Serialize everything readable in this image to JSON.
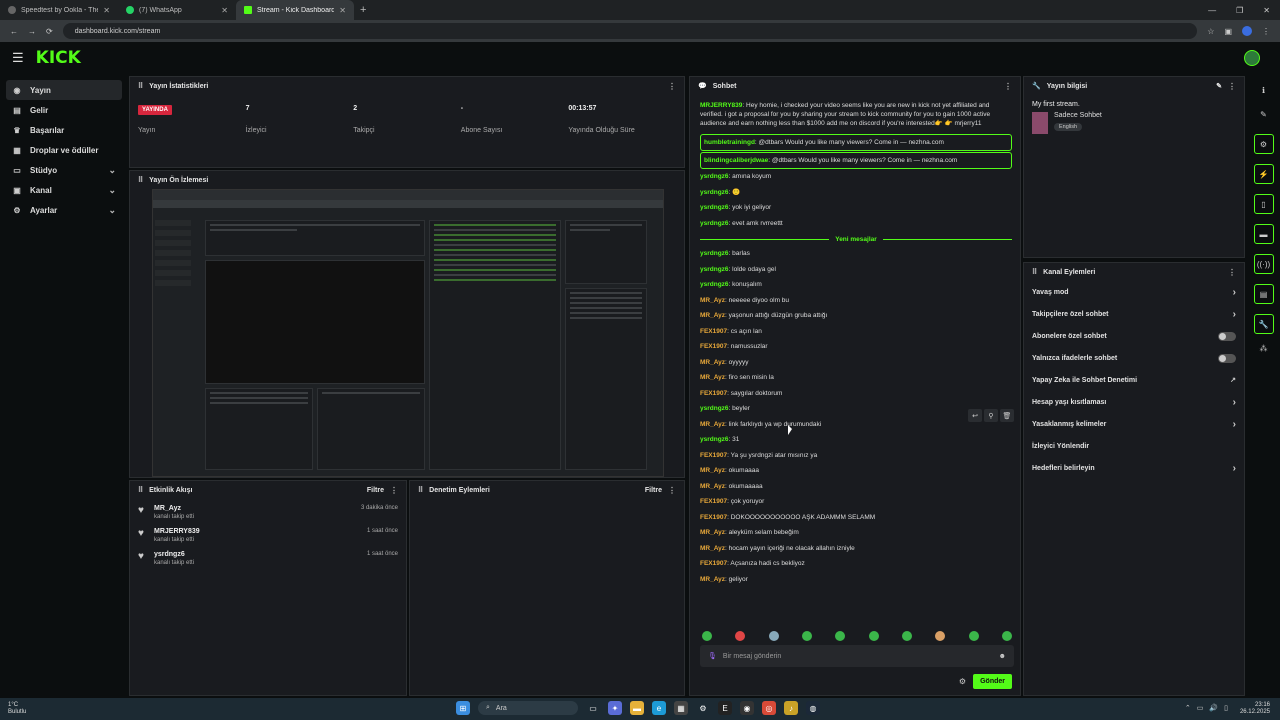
{
  "browser": {
    "tabs": [
      {
        "title": "Speedtest by Ookla - The Glob",
        "color": "#5a5a5a"
      },
      {
        "title": "(7) WhatsApp",
        "color": "#25d366"
      },
      {
        "title": "Stream - Kick Dashboard",
        "color": "#53fc18"
      }
    ],
    "url": "dashboard.kick.com/stream"
  },
  "app": {
    "logo": "KICK"
  },
  "sidebar": {
    "items": [
      {
        "label": "Yayın",
        "icon": "broadcast-icon"
      },
      {
        "label": "Gelir",
        "icon": "revenue-icon"
      },
      {
        "label": "Başarılar",
        "icon": "trophy-icon"
      },
      {
        "label": "Droplar ve ödüller",
        "icon": "gift-icon"
      },
      {
        "label": "Stüdyo",
        "icon": "studio-icon"
      },
      {
        "label": "Kanal",
        "icon": "channel-icon"
      },
      {
        "label": "Ayarlar",
        "icon": "gear-icon"
      }
    ]
  },
  "stats": {
    "title": "Yayın İstatistikleri",
    "live_badge": "YAYINDA",
    "items": [
      {
        "value": "",
        "label": "Yayın"
      },
      {
        "value": "7",
        "label": "İzleyici"
      },
      {
        "value": "2",
        "label": "Takipçi"
      },
      {
        "value": "-",
        "label": "Abone Sayısı"
      },
      {
        "value": "00:13:57",
        "label": "Yayında Olduğu Süre"
      }
    ]
  },
  "preview": {
    "title": "Yayın Ön İzlemesi"
  },
  "activity": {
    "title": "Etkinlik Akışı",
    "filter": "Filtre",
    "items": [
      {
        "name": "MR_Ayz",
        "sub": "kanalı takip etti",
        "time": "3 dakika önce"
      },
      {
        "name": "MRJERRY839",
        "sub": "kanalı takip etti",
        "time": "1 saat önce"
      },
      {
        "name": "ysrdngz6",
        "sub": "kanalı takip etti",
        "time": "1 saat önce"
      }
    ]
  },
  "modactions": {
    "title": "Denetim Eylemleri",
    "filter": "Filtre"
  },
  "chat": {
    "title": "Sohbet",
    "new_messages": "Yeni mesajlar",
    "input_placeholder": "Bir mesaj gönderin",
    "send": "Gönder",
    "messages_top": [
      {
        "user": "MRJERRY839",
        "color": "#53fc18",
        "text": "Hey homie, i checked your video seems like you are new in kick not yet affiliated and verified. i got a proposal for you by sharing your stream to kick community for you to gain 1000 active audience and earn nothing less than $1000 add me on discord if you're interested👉 👉 mrjerry11",
        "hl": false
      },
      {
        "user": "humbletrainingd",
        "color": "#53fc18",
        "text": "@dtbars Would you like many viewers? Come in — nezhna.com",
        "hl": true
      },
      {
        "user": "blindingcaliberjdwae",
        "color": "#53fc18",
        "text": "@dtbars Would you like many viewers? Come in — nezhna.com",
        "hl": true
      },
      {
        "user": "ysrdngz6",
        "color": "#53fc18",
        "text": "amına koyum",
        "hl": false
      },
      {
        "user": "ysrdngz6",
        "color": "#53fc18",
        "text": "🙂",
        "hl": false
      },
      {
        "user": "ysrdngz6",
        "color": "#53fc18",
        "text": "yok iyi geliyor",
        "hl": false
      },
      {
        "user": "ysrdngz6",
        "color": "#53fc18",
        "text": "evet amk rvrreettt",
        "hl": false
      }
    ],
    "messages_new": [
      {
        "user": "ysrdngz6",
        "color": "#53fc18",
        "text": "barlas"
      },
      {
        "user": "ysrdngz6",
        "color": "#53fc18",
        "text": "lolde odaya gel"
      },
      {
        "user": "ysrdngz6",
        "color": "#53fc18",
        "text": "konuşalım"
      },
      {
        "user": "MR_Ayz",
        "color": "#e8a83a",
        "text": "neeeee diyoo olm bu"
      },
      {
        "user": "MR_Ayz",
        "color": "#e8a83a",
        "text": "yaşonun attığı düzgün gruba attığı"
      },
      {
        "user": "FEX1907",
        "color": "#e8a83a",
        "text": "cs açın lan"
      },
      {
        "user": "FEX1907",
        "color": "#e8a83a",
        "text": "namussuzlar"
      },
      {
        "user": "MR_Ayz",
        "color": "#e8a83a",
        "text": "oyyyyy"
      },
      {
        "user": "MR_Ayz",
        "color": "#e8a83a",
        "text": "firo sen misin la"
      },
      {
        "user": "FEX1907",
        "color": "#e8a83a",
        "text": "saygılar doktorum"
      },
      {
        "user": "ysrdngz6",
        "color": "#53fc18",
        "text": "beyler"
      },
      {
        "user": "MR_Ayz",
        "color": "#e8a83a",
        "text": "link farklıydı ya wp durumundaki"
      },
      {
        "user": "ysrdngz6",
        "color": "#53fc18",
        "text": "31"
      },
      {
        "user": "FEX1907",
        "color": "#e8a83a",
        "text": "Ya şu ysrdngzi atar mısınız ya"
      },
      {
        "user": "MR_Ayz",
        "color": "#e8a83a",
        "text": "okumaaaa"
      },
      {
        "user": "MR_Ayz",
        "color": "#e8a83a",
        "text": "okumaaaaa"
      },
      {
        "user": "FEX1907",
        "color": "#e8a83a",
        "text": "çok yoruyor"
      },
      {
        "user": "FEX1907",
        "color": "#e8a83a",
        "text": "DOKOOOOOOOOOOO AŞK ADAMMM SELAMM"
      },
      {
        "user": "MR_Ayz",
        "color": "#e8a83a",
        "text": "aleyküm selam bebeğim"
      },
      {
        "user": "MR_Ayz",
        "color": "#e8a83a",
        "text": "hocam yayın içeriği ne olacak allahın izniyle"
      },
      {
        "user": "FEX1907",
        "color": "#e8a83a",
        "text": "Açsanıza hadi cs bekliyoz"
      },
      {
        "user": "MR_Ayz",
        "color": "#e8a83a",
        "text": "geliyor"
      }
    ]
  },
  "info": {
    "title": "Yayın bilgisi",
    "stream_title": "My first stream.",
    "category": "Sadece Sohbet",
    "tag": "English"
  },
  "channel_actions": {
    "title": "Kanal Eylemleri",
    "items": [
      {
        "label": "Yavaş mod",
        "control": "arrow"
      },
      {
        "label": "Takipçilere özel sohbet",
        "control": "arrow"
      },
      {
        "label": "Abonelere özel sohbet",
        "control": "toggle"
      },
      {
        "label": "Yalnızca ifadelerle sohbet",
        "control": "toggle"
      },
      {
        "label": "Yapay Zeka ile Sohbet Denetimi",
        "control": "external"
      },
      {
        "label": "Hesap yaşı kısıtlaması",
        "control": "arrow"
      },
      {
        "label": "Yasaklanmış kelimeler",
        "control": "arrow"
      },
      {
        "label": "İzleyici Yönlendir",
        "control": "none"
      },
      {
        "label": "Hedefleri belirleyin",
        "control": "arrow"
      }
    ]
  },
  "taskbar": {
    "weather_temp": "1°C",
    "weather_desc": "Bulutlu",
    "search": "Ara",
    "time": "23:16",
    "date": "26.12.2025"
  }
}
